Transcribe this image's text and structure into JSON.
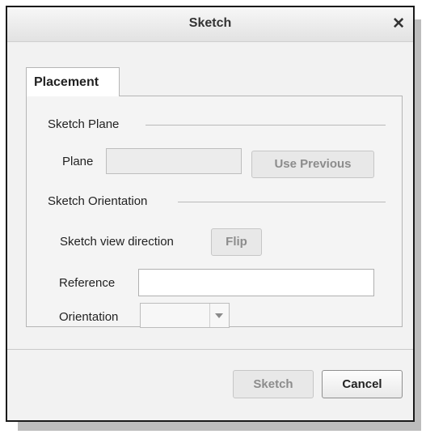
{
  "dialog": {
    "title": "Sketch",
    "close_label": "✕"
  },
  "tabs": [
    {
      "label": "Placement",
      "active": true
    }
  ],
  "sketch_plane": {
    "group_label": "Sketch Plane",
    "plane_label": "Plane",
    "plane_value": "",
    "use_previous_label": "Use Previous",
    "use_previous_enabled": false
  },
  "sketch_orientation": {
    "group_label": "Sketch Orientation",
    "view_direction_label": "Sketch view direction",
    "flip_label": "Flip",
    "flip_enabled": false,
    "reference_label": "Reference",
    "reference_value": "",
    "orientation_label": "Orientation",
    "orientation_value": ""
  },
  "footer": {
    "sketch_label": "Sketch",
    "sketch_enabled": false,
    "cancel_label": "Cancel"
  }
}
